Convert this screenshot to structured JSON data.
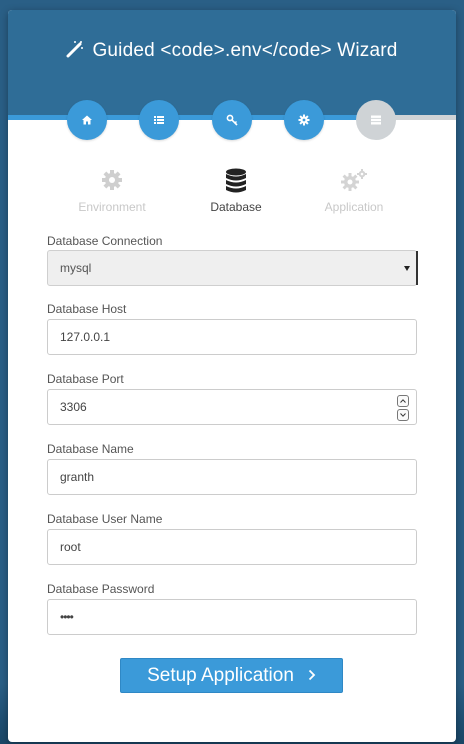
{
  "wizard": {
    "title": "Guided <code>.env</code> Wizard",
    "steps": [
      {
        "icon": "home-icon",
        "state": "complete"
      },
      {
        "icon": "list-icon",
        "state": "complete"
      },
      {
        "icon": "key-icon",
        "state": "complete"
      },
      {
        "icon": "gear-icon",
        "state": "complete"
      },
      {
        "icon": "server-icon",
        "state": "inactive"
      }
    ],
    "tabs": [
      {
        "label": "Environment",
        "icon": "gear-icon",
        "active": false
      },
      {
        "label": "Database",
        "icon": "database-icon",
        "active": true
      },
      {
        "label": "Application",
        "icon": "gears-icon",
        "active": false
      }
    ]
  },
  "form": {
    "connection": {
      "label": "Database Connection",
      "value": "mysql"
    },
    "host": {
      "label": "Database Host",
      "value": "127.0.0.1"
    },
    "port": {
      "label": "Database Port",
      "value": "3306"
    },
    "name": {
      "label": "Database Name",
      "value": "granth"
    },
    "user": {
      "label": "Database User Name",
      "value": "root"
    },
    "password": {
      "label": "Database Password",
      "value": "••••"
    },
    "submit_label": "Setup Application"
  },
  "colors": {
    "background": "#2a5f86",
    "header": "#2f6d97",
    "accent": "#3b9ad9",
    "inactive_step": "#cfd3d6"
  }
}
